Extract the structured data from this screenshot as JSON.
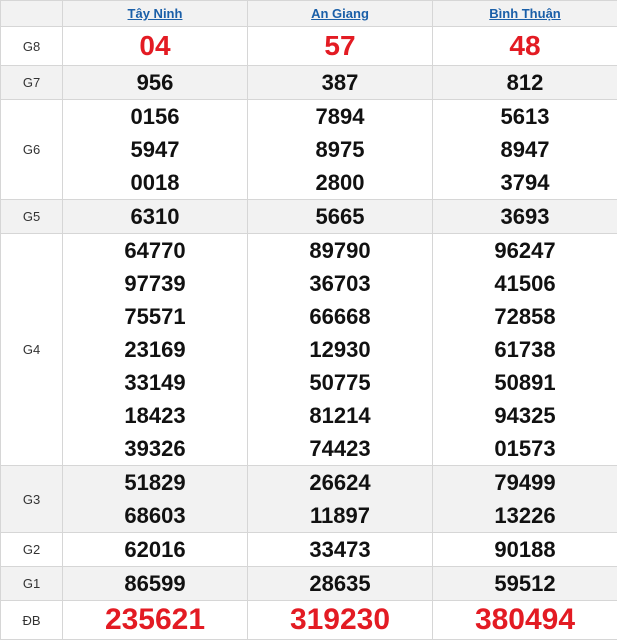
{
  "provinces": [
    "Tây Ninh",
    "An Giang",
    "Bình Thuận"
  ],
  "colors": {
    "accent_red": "#e31b23",
    "link_blue": "#1a5fa8",
    "alt_row": "#f2f2f2"
  },
  "rows": [
    {
      "label": "G8",
      "values": [
        [
          "04"
        ],
        [
          "57"
        ],
        [
          "48"
        ]
      ]
    },
    {
      "label": "G7",
      "values": [
        [
          "956"
        ],
        [
          "387"
        ],
        [
          "812"
        ]
      ]
    },
    {
      "label": "G6",
      "values": [
        [
          "0156",
          "5947",
          "0018"
        ],
        [
          "7894",
          "8975",
          "2800"
        ],
        [
          "5613",
          "8947",
          "3794"
        ]
      ]
    },
    {
      "label": "G5",
      "values": [
        [
          "6310"
        ],
        [
          "5665"
        ],
        [
          "3693"
        ]
      ]
    },
    {
      "label": "G4",
      "values": [
        [
          "64770",
          "97739",
          "75571",
          "23169",
          "33149",
          "18423",
          "39326"
        ],
        [
          "89790",
          "36703",
          "66668",
          "12930",
          "50775",
          "81214",
          "74423"
        ],
        [
          "96247",
          "41506",
          "72858",
          "61738",
          "50891",
          "94325",
          "01573"
        ]
      ]
    },
    {
      "label": "G3",
      "values": [
        [
          "51829",
          "68603"
        ],
        [
          "26624",
          "11897"
        ],
        [
          "79499",
          "13226"
        ]
      ]
    },
    {
      "label": "G2",
      "values": [
        [
          "62016"
        ],
        [
          "33473"
        ],
        [
          "90188"
        ]
      ]
    },
    {
      "label": "G1",
      "values": [
        [
          "86599"
        ],
        [
          "28635"
        ],
        [
          "59512"
        ]
      ]
    },
    {
      "label": "ĐB",
      "values": [
        [
          "235621"
        ],
        [
          "319230"
        ],
        [
          "380494"
        ]
      ]
    }
  ]
}
